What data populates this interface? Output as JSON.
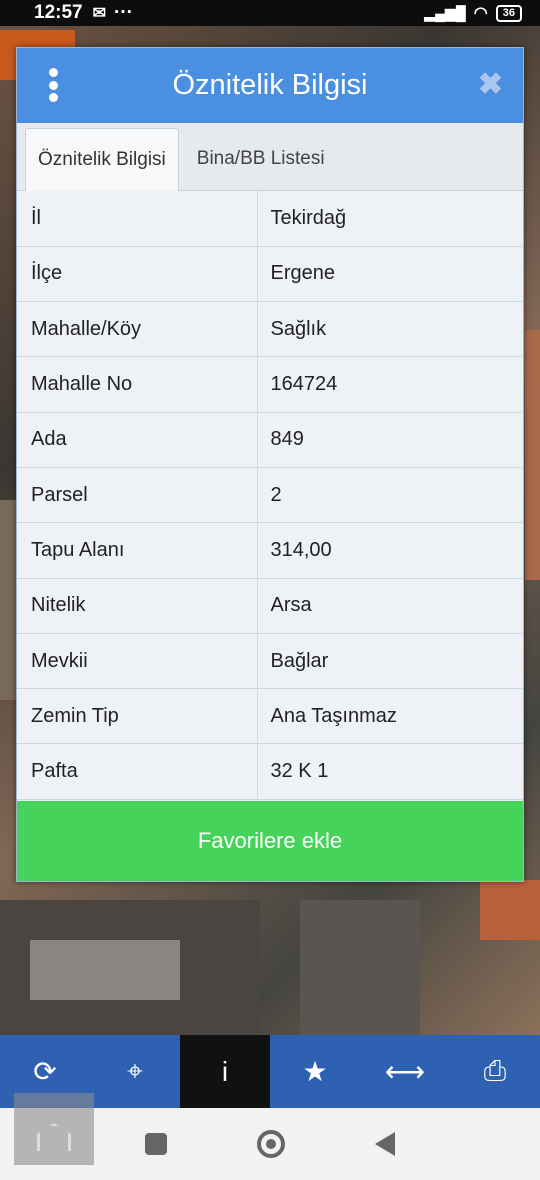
{
  "status_bar": {
    "time": "12:57",
    "more": "···",
    "battery": "36"
  },
  "dialog": {
    "title": "Öznitelik Bilgisi",
    "close_symbol": "✖",
    "tabs": [
      {
        "label": "Öznitelik Bilgisi",
        "active": true
      },
      {
        "label": "Bina/BB Listesi",
        "active": false
      }
    ],
    "rows": [
      {
        "key": "İl",
        "value": "Tekirdağ"
      },
      {
        "key": "İlçe",
        "value": "Ergene"
      },
      {
        "key": "Mahalle/Köy",
        "value": "Sağlık"
      },
      {
        "key": "Mahalle No",
        "value": "164724"
      },
      {
        "key": "Ada",
        "value": "849"
      },
      {
        "key": "Parsel",
        "value": "2"
      },
      {
        "key": "Tapu Alanı",
        "value": "314,00"
      },
      {
        "key": "Nitelik",
        "value": "Arsa"
      },
      {
        "key": "Mevkii",
        "value": "Bağlar"
      },
      {
        "key": "Zemin Tip",
        "value": "Ana Taşınmaz"
      },
      {
        "key": "Pafta",
        "value": "32 K 1"
      }
    ],
    "favorite_button": "Favorilere ekle"
  },
  "toolbar": {
    "items": [
      {
        "icon": "refresh-icon",
        "glyph": "⟳"
      },
      {
        "icon": "locate-icon",
        "glyph": "⌖"
      },
      {
        "icon": "info-icon",
        "glyph": "i",
        "active": true
      },
      {
        "icon": "star-icon",
        "glyph": "★"
      },
      {
        "icon": "measure-icon",
        "glyph": "⟷"
      },
      {
        "icon": "print-icon",
        "glyph": "⎙"
      }
    ]
  },
  "colors": {
    "header": "#4a8fe0",
    "button": "#45d35a",
    "toolbar": "#2f61b3"
  }
}
